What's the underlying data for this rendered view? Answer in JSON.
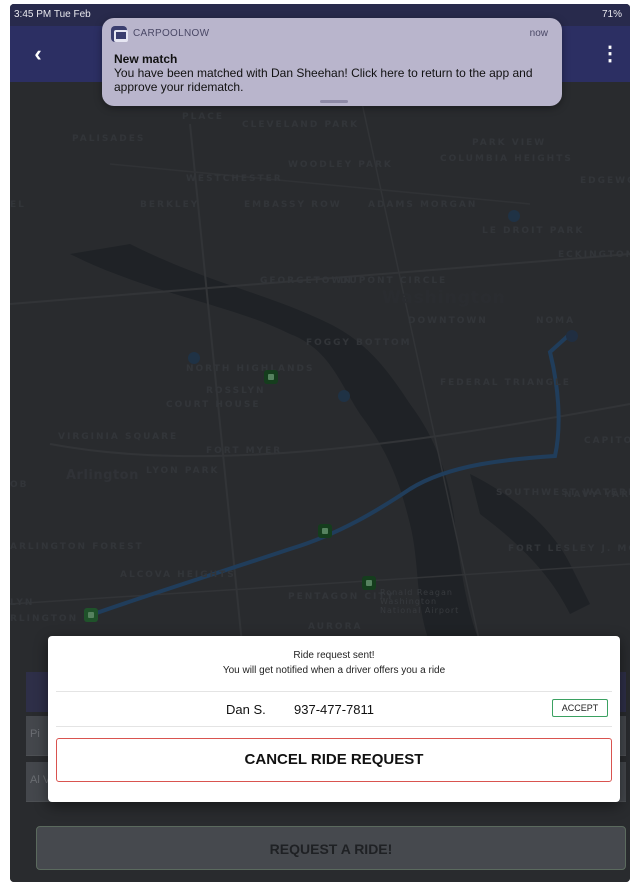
{
  "status_bar": {
    "time": "3:45 PM  Tue Feb",
    "right": "71%"
  },
  "nav": {
    "back_icon": "chevron-left-icon",
    "back_glyph": "‹",
    "menu_icon": "more-vertical-icon",
    "menu_glyph": "⋮"
  },
  "notification": {
    "app_name": "CARPOOLNOW",
    "time": "now",
    "title": "New match",
    "body": "You have been matched with Dan Sheehan!  Click here to return to the app and approve your ridematch."
  },
  "map": {
    "labels": [
      "PALISADES",
      "PLACE",
      "CLEVELAND PARK",
      "PARK VIEW",
      "WOODLEY PARK",
      "COLUMBIA HEIGHTS",
      "WESTCHESTER",
      "EDGEWOO",
      "BERKLEY",
      "EMBASSY ROW",
      "ADAMS MORGAN",
      "LE DROIT PARK",
      "ECKINGTON",
      "GEORGETOWN",
      "DUPONT CIRCLE",
      "Washington",
      "DOWNTOWN",
      "NOMA",
      "FOGGY BOTTOM",
      "NORTH HIGHLANDS",
      "ROSSLYN",
      "COURT HOUSE",
      "FEDERAL TRIANGLE",
      "VIRGINIA SQUARE",
      "FORT MYER",
      "CAPITOL H",
      "Arlington",
      "LYON PARK",
      "SOUTHWEST WATERFRONT",
      "NAVY YAR",
      "ARLINGTON FOREST",
      "FORT LESLEY J. MCNAIR",
      "ALCOVA HEIGHTS",
      "PENTAGON CITY",
      "Ronald Reagan Washington National Airport",
      "AURORA",
      "LYN",
      "RLINGTON",
      "OB",
      "EL"
    ]
  },
  "form": {
    "field1_placeholder": "Pi",
    "field2_placeholder": "Al  Va"
  },
  "request_button": "REQUEST A RIDE!",
  "modal": {
    "line1": "Ride request sent!",
    "line2": "You will get notified when a driver offers you a ride",
    "driver_name": "Dan S.",
    "driver_phone": "937-477-7811",
    "accept_label": "ACCEPT",
    "cancel_label": "CANCEL RIDE REQUEST"
  }
}
